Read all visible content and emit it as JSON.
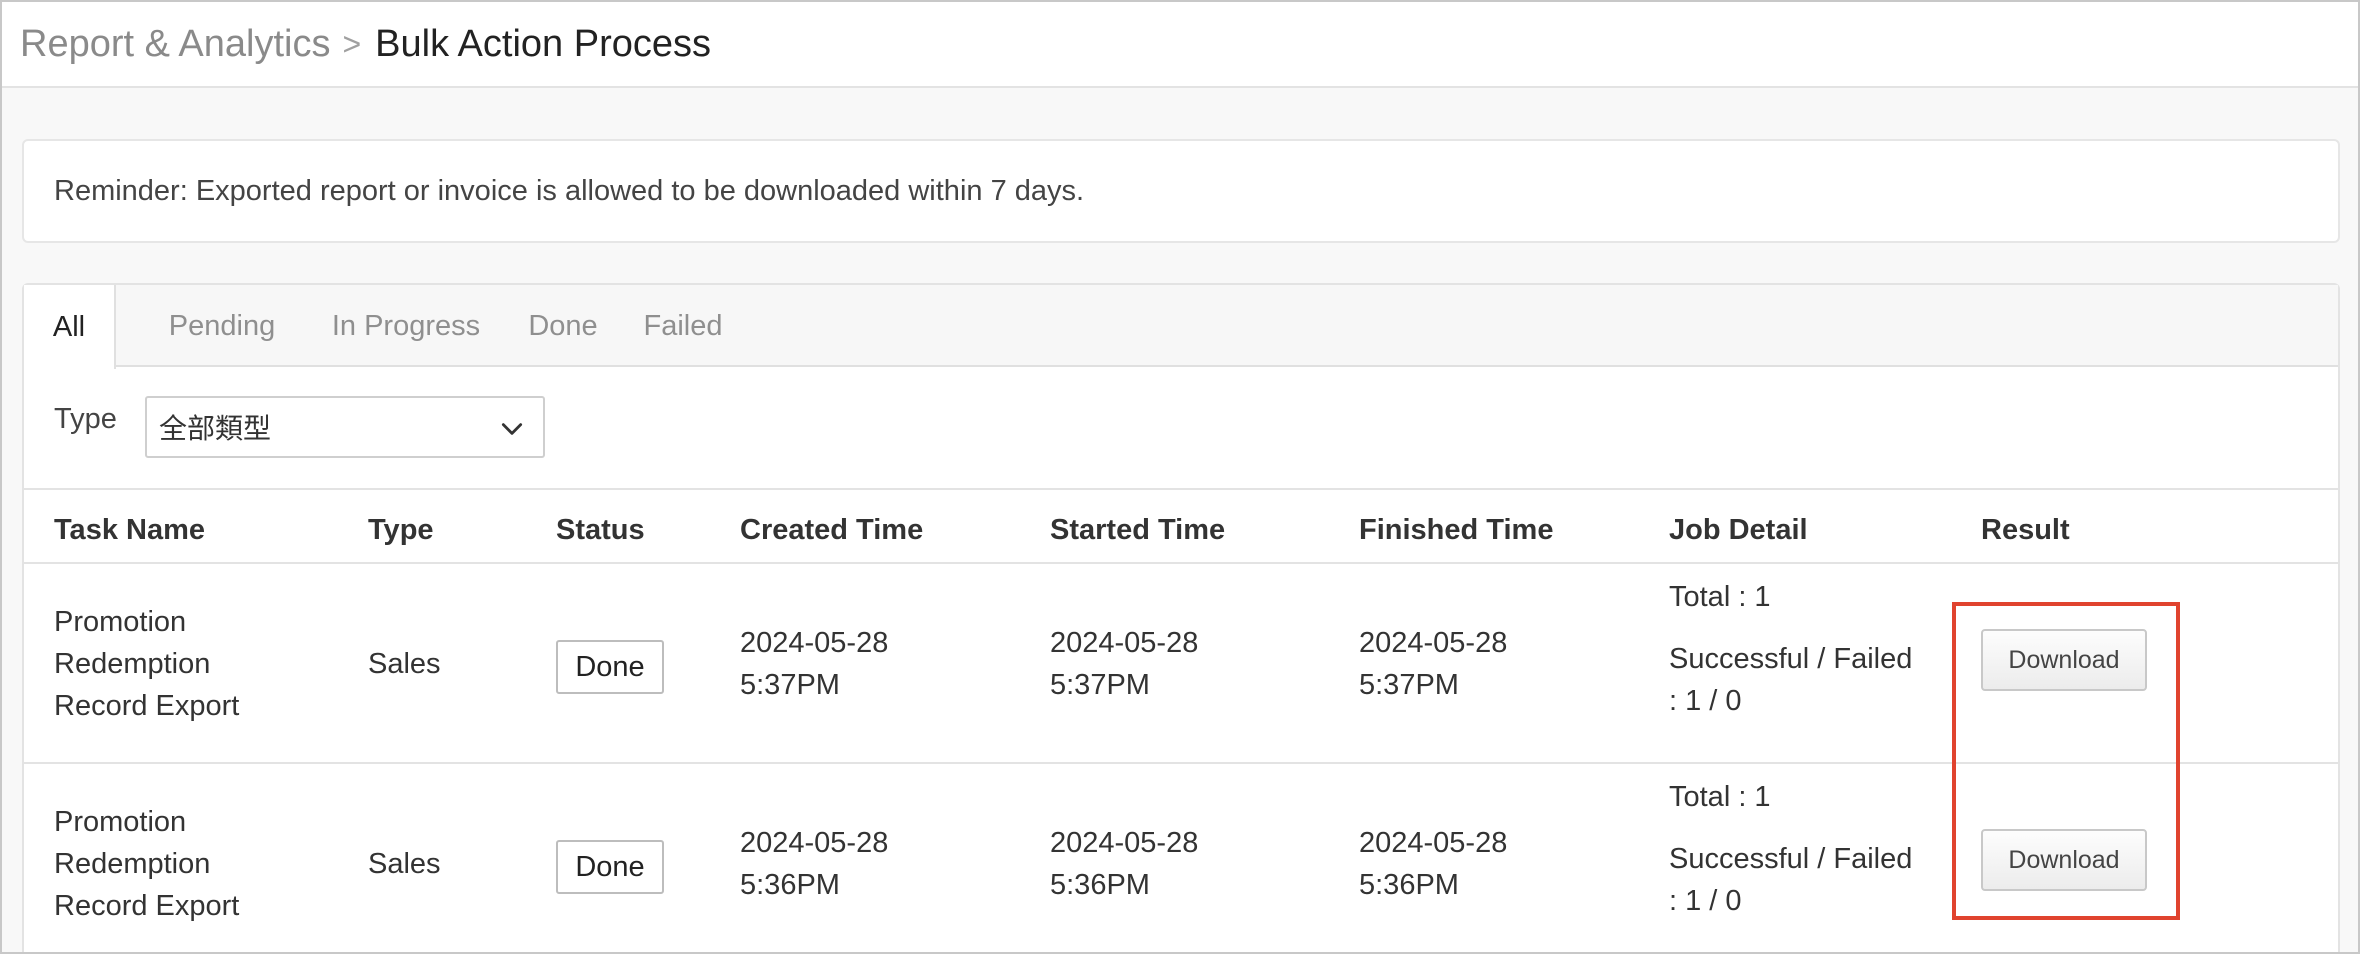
{
  "breadcrumb": {
    "parent": "Report & Analytics",
    "separator": ">",
    "current": "Bulk Action Process"
  },
  "reminder": {
    "text": "Reminder: Exported report or invoice is allowed to be downloaded within 7 days."
  },
  "tabs": [
    {
      "label": "All",
      "active": true
    },
    {
      "label": "Pending",
      "active": false
    },
    {
      "label": "In Progress",
      "active": false
    },
    {
      "label": "Done",
      "active": false
    },
    {
      "label": "Failed",
      "active": false
    }
  ],
  "filter": {
    "label": "Type",
    "selected": "全部類型"
  },
  "table": {
    "headers": [
      "Task Name",
      "Type",
      "Status",
      "Created Time",
      "Started Time",
      "Finished Time",
      "Job Detail",
      "Result"
    ],
    "rows": [
      {
        "task_name": [
          "Promotion",
          "Redemption",
          "Record Export"
        ],
        "type": "Sales",
        "status": "Done",
        "created": [
          "2024-05-28",
          "5:37PM"
        ],
        "started": [
          "2024-05-28",
          "5:37PM"
        ],
        "finished": [
          "2024-05-28",
          "5:37PM"
        ],
        "job_total": "Total : 1",
        "job_result": [
          "Successful / Failed",
          ": 1 / 0"
        ],
        "result_button": "Download"
      },
      {
        "task_name": [
          "Promotion",
          "Redemption",
          "Record Export"
        ],
        "type": "Sales",
        "status": "Done",
        "created": [
          "2024-05-28",
          "5:36PM"
        ],
        "started": [
          "2024-05-28",
          "5:36PM"
        ],
        "finished": [
          "2024-05-28",
          "5:36PM"
        ],
        "job_total": "Total : 1",
        "job_result": [
          "Successful / Failed",
          ": 1 / 0"
        ],
        "result_button": "Download"
      }
    ]
  },
  "colors": {
    "highlight": "#e0432e",
    "active_tab_text": "#222222",
    "inactive_tab_text": "#8f8f8f"
  },
  "icons": {
    "select_caret": "chevron-down-icon",
    "breadcrumb_separator": "chevron-right-icon"
  }
}
